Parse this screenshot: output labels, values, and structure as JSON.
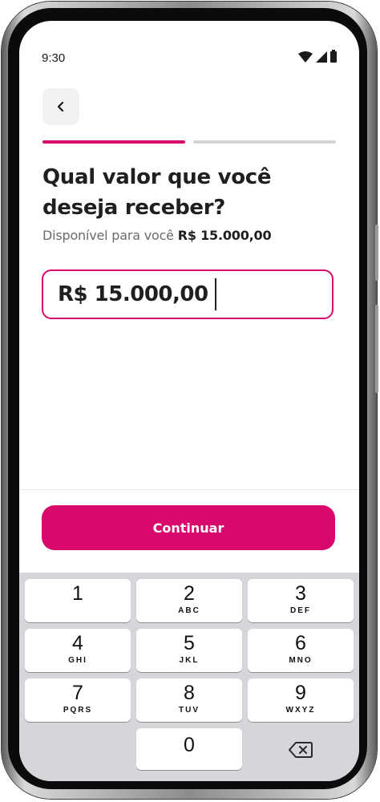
{
  "status_bar": {
    "time": "9:30"
  },
  "header": {
    "back_icon": "chevron-left-icon"
  },
  "progress": {
    "steps": 2,
    "current": 1
  },
  "title": "Qual valor que você deseja receber?",
  "available": {
    "label": "Disponível para você",
    "amount": "R$ 15.000,00"
  },
  "amount_input": {
    "value": "R$ 15.000,00"
  },
  "continue_button": {
    "label": "Continuar"
  },
  "keypad": {
    "keys": [
      {
        "digit": "1",
        "letters": ""
      },
      {
        "digit": "2",
        "letters": "ABC"
      },
      {
        "digit": "3",
        "letters": "DEF"
      },
      {
        "digit": "4",
        "letters": "GHI"
      },
      {
        "digit": "5",
        "letters": "JKL"
      },
      {
        "digit": "6",
        "letters": "MNO"
      },
      {
        "digit": "7",
        "letters": "PQRS"
      },
      {
        "digit": "8",
        "letters": "TUV"
      },
      {
        "digit": "9",
        "letters": "WXYZ"
      },
      {
        "digit": "0",
        "letters": ""
      }
    ],
    "backspace_icon": "backspace-icon"
  },
  "colors": {
    "accent": "#d8086c",
    "keypad_bg": "#d4d6da"
  }
}
